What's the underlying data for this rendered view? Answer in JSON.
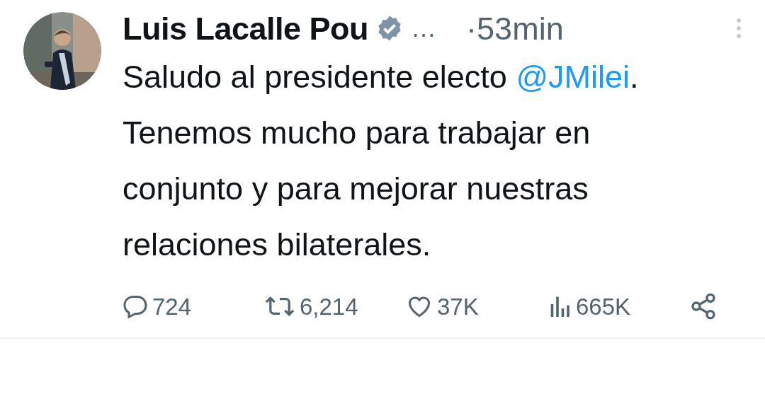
{
  "author": {
    "name": "Luis Lacalle Pou",
    "verified": true,
    "more": "…",
    "time": "·53min"
  },
  "body": {
    "before": "Saludo al presidente electo ",
    "mention": "@JMilei",
    "after": ". Tenemos mucho para trabajar en conjunto y para mejorar nuestras relaciones bilaterales."
  },
  "actions": [
    {
      "kind": "reply",
      "count": "724"
    },
    {
      "kind": "repost",
      "count": "6,214"
    },
    {
      "kind": "like",
      "count": "37K"
    },
    {
      "kind": "views",
      "count": "665K"
    },
    {
      "kind": "share"
    }
  ]
}
